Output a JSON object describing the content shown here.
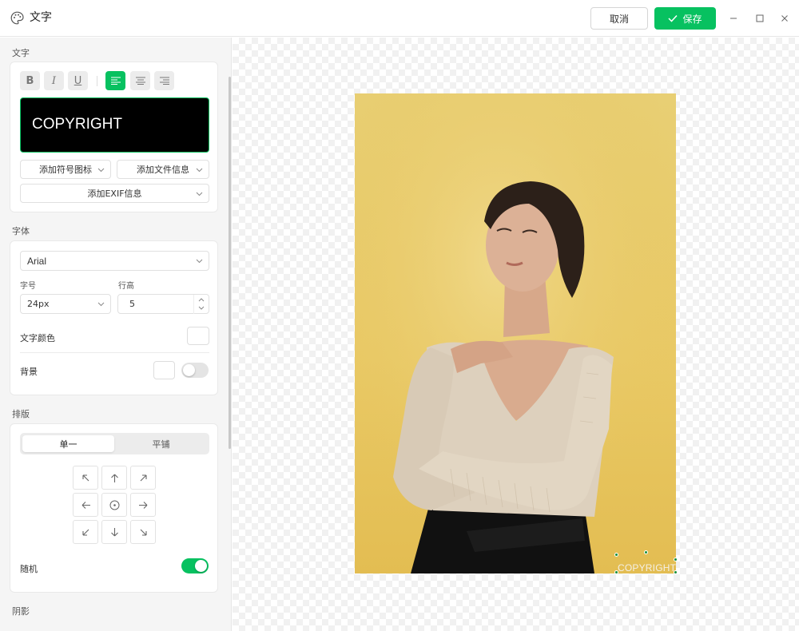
{
  "window": {
    "title": "文字",
    "cancel_label": "取消",
    "save_label": "保存",
    "accent_color": "#07c160"
  },
  "text_section": {
    "label": "文字",
    "format_buttons": [
      "B",
      "I",
      "U"
    ],
    "align_buttons": [
      "align-left",
      "align-center",
      "align-right"
    ],
    "active_align": "align-left",
    "preview_text": "COPYRIGHT",
    "add_symbol_label": "添加符号图标",
    "add_file_info_label": "添加文件信息",
    "add_exif_label": "添加EXIF信息"
  },
  "font_section": {
    "label": "字体",
    "font_family": "Arial",
    "size_label": "字号",
    "size_value": "24px",
    "line_height_label": "行高",
    "line_height_value": "5",
    "color_label": "文字颜色",
    "text_color": "#ffffff",
    "background_label": "背景",
    "background_enabled": false
  },
  "layout_section": {
    "label": "排版",
    "tabs": [
      "单一",
      "平铺"
    ],
    "active_tab": "单一",
    "random_label": "随机",
    "random_enabled": true
  },
  "shadow_section": {
    "label": "阴影"
  },
  "canvas": {
    "watermark_text": "COPYRIGHT"
  }
}
